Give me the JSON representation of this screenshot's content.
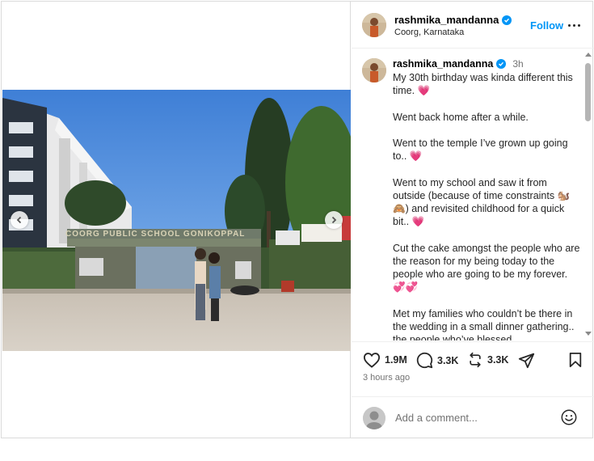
{
  "header": {
    "username": "rashmika_mandanna",
    "location": "Coorg, Karnataka",
    "follow_label": "Follow",
    "avatar_icon": "profile-avatar",
    "verified_icon": "verified-badge-icon",
    "more_icon": "more-options-icon"
  },
  "caption": {
    "username": "rashmika_mandanna",
    "time": "3h",
    "paragraphs": [
      "My 30th birthday was kinda different this time. 💗",
      "Went back home after a while.",
      "Went to the temple I’ve grown up going to.. 💗",
      "Went to my school and saw it from outside (because of time constraints 🐿️🙈) and revisited childhood for a quick bit.. 💗",
      "Cut the cake amongst the people who are the reason for my being today to the people who are going to be my forever. 💞💞",
      "Met my families who couldn’t be there in the wedding in a small dinner gathering.. the people who’ve blessed"
    ]
  },
  "actions": {
    "likes": "1.9M",
    "comments": "3.3K",
    "reposts": "3.3K",
    "like_icon": "heart-icon",
    "comment_icon": "comment-icon",
    "repost_icon": "repost-icon",
    "share_icon": "share-icon",
    "save_icon": "bookmark-icon",
    "time_ago": "3 hours ago"
  },
  "add_comment": {
    "placeholder": "Add a comment...",
    "emoji_icon": "emoji-icon"
  },
  "media": {
    "sign_text": "COORG PUBLIC SCHOOL GONIKOPPAL",
    "prev_icon": "chevron-left-icon",
    "next_icon": "chevron-right-icon"
  },
  "colors": {
    "accent": "#0095f6",
    "text": "#262626",
    "muted": "#737373",
    "border": "#dbdbdb"
  }
}
